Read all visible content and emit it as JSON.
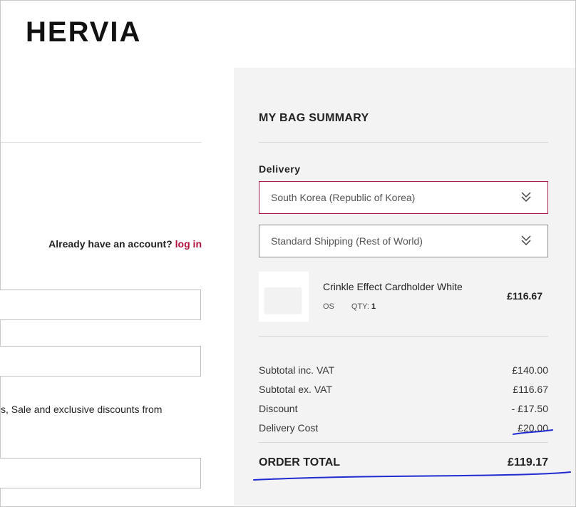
{
  "brand": {
    "logo_text": "HERVIA"
  },
  "account": {
    "prompt": "Already have an account?",
    "login_link": "log in"
  },
  "form": {
    "notice_fragment": "s, Sale and exclusive discounts from"
  },
  "summary": {
    "title": "MY BAG SUMMARY",
    "delivery_label": "Delivery",
    "country_select": "South Korea (Republic of Korea)",
    "shipping_select": "Standard Shipping (Rest of World)",
    "item": {
      "name": "Crinkle Effect Cardholder White",
      "size": "OS",
      "qty_label": "QTY:",
      "qty_value": "1",
      "price": "£116.67"
    },
    "totals": [
      {
        "label": "Subtotal inc. VAT",
        "value": "£140.00"
      },
      {
        "label": "Subtotal ex. VAT",
        "value": "£116.67"
      },
      {
        "label": "Discount",
        "value": "- £17.50"
      },
      {
        "label": "Delivery Cost",
        "value": "£20.00"
      }
    ],
    "order_total_label": "ORDER TOTAL",
    "order_total_value": "£119.17"
  },
  "colors": {
    "accent": "#b3123f",
    "panel_bg": "#f3f3f3",
    "annotation_ink": "#1f2bd1"
  },
  "icons": {
    "select_chevron": "double-chevron-down-icon"
  }
}
